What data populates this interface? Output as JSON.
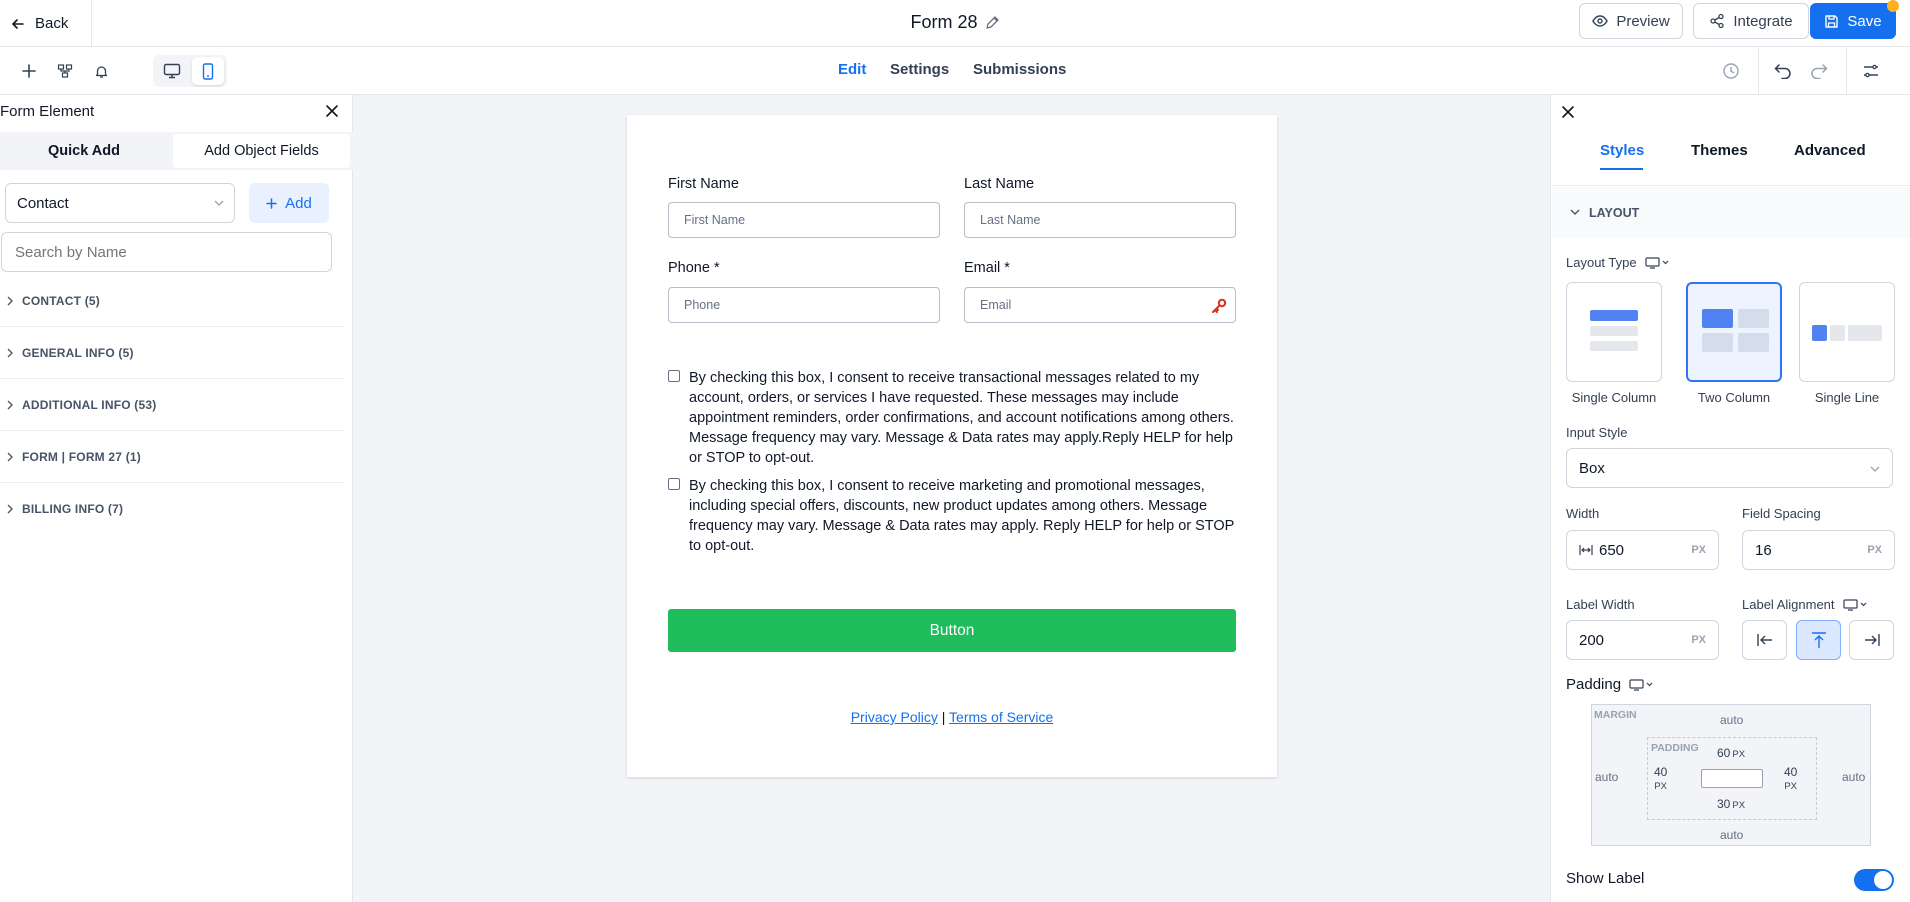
{
  "topbar": {
    "back_label": "Back",
    "title": "Form 28",
    "preview_label": "Preview",
    "integrate_label": "Integrate",
    "save_label": "Save"
  },
  "subbar": {
    "tabs": [
      "Edit",
      "Settings",
      "Submissions"
    ],
    "active_tab": "Edit"
  },
  "left_panel": {
    "title": "Form Element",
    "tabs": [
      "Quick Add",
      "Add Object Fields"
    ],
    "object_select": "Contact",
    "add_label": "Add",
    "search_placeholder": "Search by Name",
    "categories": [
      "CONTACT (5)",
      "GENERAL INFO (5)",
      "ADDITIONAL INFO (53)",
      "FORM | FORM 27 (1)",
      "BILLING INFO (7)"
    ]
  },
  "form": {
    "first_name_label": "First Name",
    "first_name_placeholder": "First Name",
    "last_name_label": "Last Name",
    "last_name_placeholder": "Last Name",
    "phone_label": "Phone *",
    "phone_placeholder": "Phone",
    "email_label": "Email *",
    "email_placeholder": "Email",
    "consent_1": "By checking this box, I consent to receive transactional messages related to my account, orders, or services I have requested. These messages may include appointment reminders, order confirmations, and account notifications among others. Message frequency may vary. Message & Data rates may apply.Reply HELP for help or STOP to opt-out.",
    "consent_2": "By checking this box, I consent to receive marketing and promotional messages, including special offers, discounts, new product updates among others. Message frequency may vary. Message & Data rates may apply. Reply HELP for help or STOP to opt-out.",
    "button_label": "Button",
    "privacy_label": "Privacy Policy",
    "separator": "|",
    "terms_label": "Terms of Service",
    "button_color": "#1ebc5a"
  },
  "right_panel": {
    "tabs": [
      "Styles",
      "Themes",
      "Advanced"
    ],
    "active_tab": "Styles",
    "section": "LAYOUT",
    "layout_type_label": "Layout Type",
    "layouts": [
      "Single Column",
      "Two Column",
      "Single Line"
    ],
    "selected_layout": "Two Column",
    "input_style_label": "Input Style",
    "input_style_value": "Box",
    "width_label": "Width",
    "width_value": "650",
    "field_spacing_label": "Field Spacing",
    "field_spacing_value": "16",
    "unit": "PX",
    "label_width_label": "Label Width",
    "label_width_value": "200",
    "label_alignment_label": "Label Alignment",
    "padding_label": "Padding",
    "margin_caption": "MARGIN",
    "padding_caption": "PADDING",
    "margin_auto": "auto",
    "padding_top": "60",
    "padding_left": "40",
    "padding_right": "40",
    "padding_bottom": "30",
    "show_label": "Show Label",
    "show_label_on": true,
    "accent": "#1570ef"
  }
}
